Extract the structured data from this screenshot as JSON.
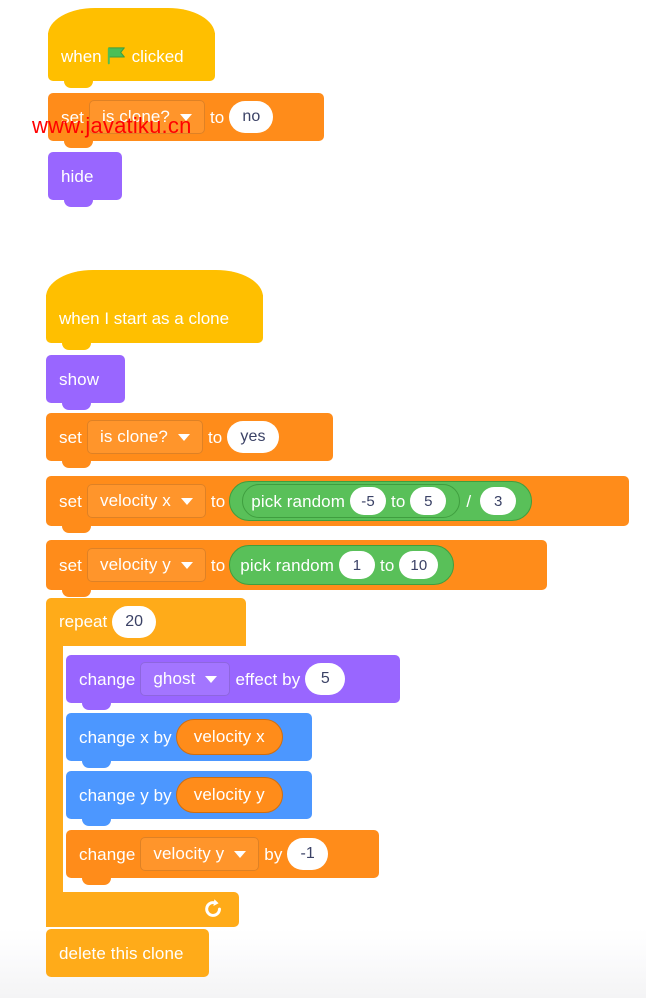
{
  "watermark": {
    "text": "www.javatiku.cn",
    "color": "#ff0000"
  },
  "palette": {
    "event": "#FFBF00",
    "control": "#FFAB19",
    "variables": "#FF8C1A",
    "looks": "#9966FF",
    "motion": "#4C97FF",
    "operators": "#59C059",
    "background": "#ffffff"
  },
  "scripts": [
    {
      "id": "script-when-flag-clicked",
      "blocks": {
        "hat": {
          "prefix": "when",
          "icon": "green-flag-icon",
          "suffix": "clicked"
        },
        "set_is_clone_no": {
          "verb": "set",
          "variable": "is clone?",
          "connector": "to",
          "value": "no"
        },
        "hide": {
          "label": "hide"
        }
      }
    },
    {
      "id": "script-when-i-start-as-a-clone",
      "blocks": {
        "hat": {
          "label": "when I start as a clone"
        },
        "show": {
          "label": "show"
        },
        "set_is_clone_yes": {
          "verb": "set",
          "variable": "is clone?",
          "connector": "to",
          "value": "yes"
        },
        "set_velocity_x": {
          "verb": "set",
          "variable": "velocity x",
          "connector": "to",
          "operator": {
            "type": "divide",
            "symbol": "/",
            "left": {
              "type": "pick-random",
              "label": "pick random",
              "from": "-5",
              "connector": "to",
              "to": "5"
            },
            "right": "3"
          }
        },
        "set_velocity_y": {
          "verb": "set",
          "variable": "velocity y",
          "connector": "to",
          "operator": {
            "type": "pick-random",
            "label": "pick random",
            "from": "1",
            "connector": "to",
            "to": "10"
          }
        },
        "repeat": {
          "label": "repeat",
          "times": "20",
          "loop_icon": "loop-arrow-icon",
          "body": {
            "change_ghost_effect": {
              "verb": "change",
              "effect": "ghost",
              "connector": "effect by",
              "value": "5"
            },
            "change_x_by": {
              "label": "change x by",
              "reporter": "velocity x"
            },
            "change_y_by": {
              "label": "change y by",
              "reporter": "velocity y"
            },
            "change_velocity_y": {
              "verb": "change",
              "variable": "velocity y",
              "connector": "by",
              "value": "-1"
            }
          }
        },
        "delete_this_clone": {
          "label": "delete this clone"
        }
      }
    }
  ]
}
